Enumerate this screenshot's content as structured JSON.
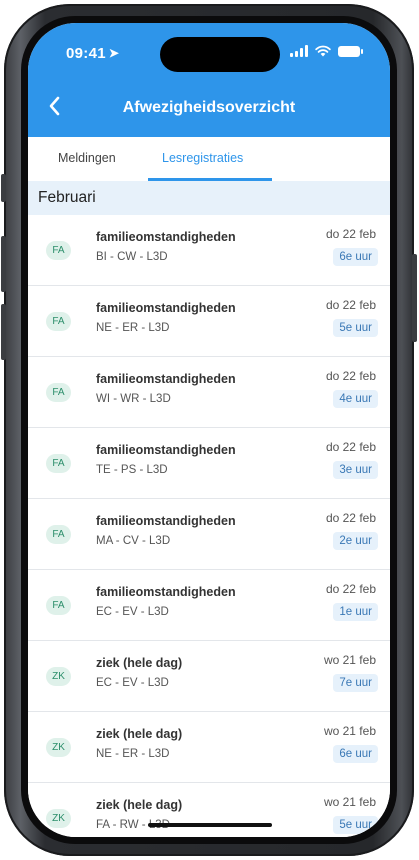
{
  "status": {
    "time": "09:41"
  },
  "appbar": {
    "title": "Afwezigheidsoverzicht"
  },
  "tabs": [
    {
      "label": "Meldingen",
      "active": false
    },
    {
      "label": "Lesregistraties",
      "active": true
    }
  ],
  "section": {
    "title": "Februari"
  },
  "rows": [
    {
      "badge": "FA",
      "reason": "familieomstandigheden",
      "sub": "BI - CW - L3D",
      "date": "do 22 feb",
      "hour": "6e uur"
    },
    {
      "badge": "FA",
      "reason": "familieomstandigheden",
      "sub": "NE - ER - L3D",
      "date": "do 22 feb",
      "hour": "5e uur"
    },
    {
      "badge": "FA",
      "reason": "familieomstandigheden",
      "sub": "WI - WR - L3D",
      "date": "do 22 feb",
      "hour": "4e uur"
    },
    {
      "badge": "FA",
      "reason": "familieomstandigheden",
      "sub": "TE - PS - L3D",
      "date": "do 22 feb",
      "hour": "3e uur"
    },
    {
      "badge": "FA",
      "reason": "familieomstandigheden",
      "sub": "MA - CV - L3D",
      "date": "do 22 feb",
      "hour": "2e uur"
    },
    {
      "badge": "FA",
      "reason": "familieomstandigheden",
      "sub": "EC - EV - L3D",
      "date": "do 22 feb",
      "hour": "1e uur"
    },
    {
      "badge": "ZK",
      "reason": "ziek (hele dag)",
      "sub": "EC - EV - L3D",
      "date": "wo 21 feb",
      "hour": "7e uur"
    },
    {
      "badge": "ZK",
      "reason": "ziek (hele dag)",
      "sub": "NE - ER - L3D",
      "date": "wo 21 feb",
      "hour": "6e uur"
    },
    {
      "badge": "ZK",
      "reason": "ziek (hele dag)",
      "sub": "FA - RW - L3D",
      "date": "wo 21 feb",
      "hour": "5e uur"
    }
  ],
  "colors": {
    "accent": "#2e95ea",
    "section_bg": "#e7f1fa",
    "badge_bg": "#dff1ea",
    "badge_text": "#2b8e6a"
  },
  "icons": [
    "back-chevron-icon",
    "location-arrow-icon",
    "signal-icon",
    "wifi-icon",
    "battery-icon"
  ]
}
